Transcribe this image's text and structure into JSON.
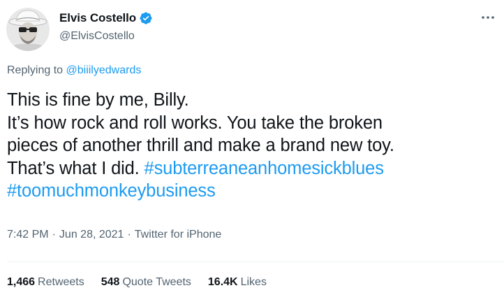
{
  "author": {
    "display_name": "Elvis Costello",
    "handle": "@ElvisCostello",
    "verified": true,
    "verified_color": "#1d9bf0"
  },
  "reply": {
    "prefix": "Replying to",
    "mention": "@biiilyedwards"
  },
  "tweet": {
    "line1": "This is fine by me, Billy.",
    "line2": "It’s how rock and roll works. You take the broken",
    "line3": "pieces of another thrill and make a brand new toy.",
    "line4_text": "That’s what I did.",
    "hashtag1": "#subterreaneanhomesickblues",
    "hashtag2": "#toomuchmonkeybusiness"
  },
  "meta": {
    "time": "7:42 PM",
    "separator": "·",
    "date": "Jun 28, 2021",
    "source": "Twitter for iPhone"
  },
  "stats": {
    "retweets_count": "1,466",
    "retweets_label": "Retweets",
    "quotes_count": "548",
    "quotes_label": "Quote Tweets",
    "likes_count": "16.4K",
    "likes_label": "Likes"
  },
  "colors": {
    "text": "#0f1419",
    "secondary": "#536471",
    "link": "#1d9bf0"
  },
  "icons": {
    "more": "more-horizontal-icon",
    "verified": "verified-badge-icon"
  }
}
